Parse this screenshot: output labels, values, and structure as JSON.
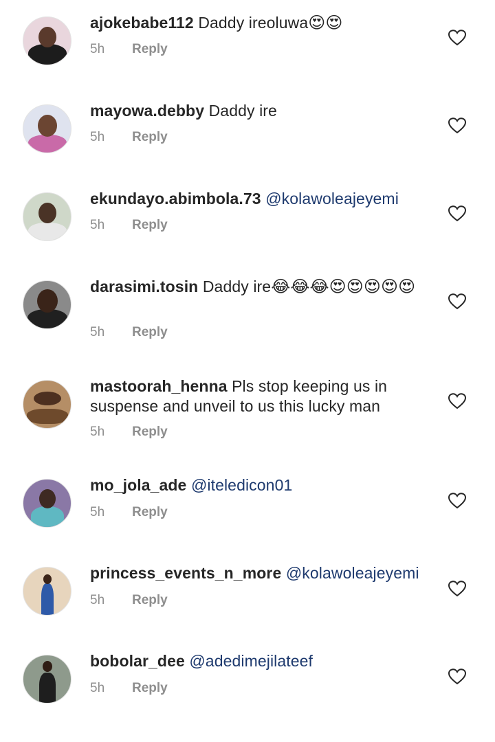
{
  "comments": [
    {
      "username": "ajokebabe112",
      "text": "Daddy ireoluwa",
      "emoji": "😍😍",
      "mention": "",
      "time": "5h",
      "reply": "Reply",
      "icons": [
        "heart-eyes-emoji",
        "heart-icon"
      ]
    },
    {
      "username": "mayowa.debby",
      "text": "Daddy ire",
      "emoji": "",
      "mention": "",
      "time": "5h",
      "reply": "Reply",
      "icons": [
        "heart-icon"
      ]
    },
    {
      "username": "ekundayo.abimbola.73",
      "text": "",
      "emoji": "",
      "mention": "@kolawoleajeyemi",
      "time": "5h",
      "reply": "Reply",
      "icons": [
        "heart-icon"
      ]
    },
    {
      "username": "darasimi.tosin",
      "text": "Daddy ire",
      "emoji": "😂😂😂😍😍😍😍😍",
      "mention": "",
      "time": "5h",
      "reply": "Reply",
      "icons": [
        "tears-of-joy-emoji",
        "heart-eyes-emoji",
        "heart-icon"
      ]
    },
    {
      "username": "mastoorah_henna",
      "text": "Pls stop keeping us in suspense and unveil to us this lucky man",
      "emoji": "",
      "mention": "",
      "time": "5h",
      "reply": "Reply",
      "icons": [
        "heart-icon"
      ]
    },
    {
      "username": "mo_jola_ade",
      "text": "",
      "emoji": "",
      "mention": "@iteledicon01",
      "time": "5h",
      "reply": "Reply",
      "icons": [
        "heart-icon"
      ]
    },
    {
      "username": "princess_events_n_more",
      "text": "",
      "emoji": "",
      "mention": "@kolawoleajeyemi",
      "time": "5h",
      "reply": "Reply",
      "icons": [
        "heart-icon"
      ]
    },
    {
      "username": "bobolar_dee",
      "text": "",
      "emoji": "",
      "mention": "@adedimejilateef",
      "time": "5h",
      "reply": "Reply",
      "icons": [
        "heart-icon"
      ]
    }
  ],
  "colors": {
    "username": "#262626",
    "mention": "#1e3a6e",
    "meta": "#8e8e8e",
    "heart_outline": "#262626"
  }
}
